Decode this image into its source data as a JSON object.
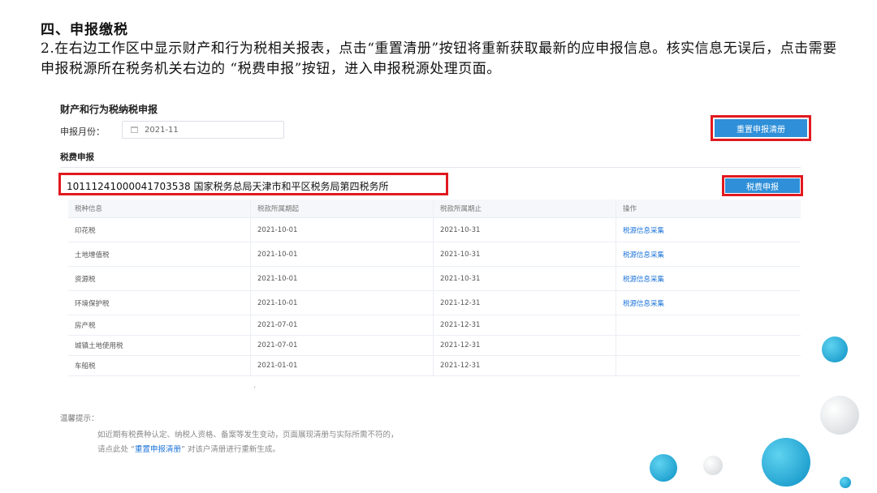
{
  "slide": {
    "heading": "四、申报缴税",
    "paragraph": "2.在右边工作区中显示财产和行为税相关报表，点击“重置清册”按钮将重新获取最新的应申报信息。核实信息无误后，点击需要申报税源所在税务机关右边的 “税费申报”按钮，进入申报税源处理页面。"
  },
  "app": {
    "section_title": "财产和行为税纳税申报",
    "month_label": "申报月份：",
    "month_value": "2021-11",
    "reset_button": "重置申报清册",
    "sub_title": "税费申报",
    "org_line": "10111241000041703538 国家税务总局天津市和平区税务局第四税务所",
    "declare_button": "税费申报",
    "table": {
      "headers": [
        "税种信息",
        "税款所属期起",
        "税款所属期止",
        "操作"
      ],
      "rows": [
        {
          "tax": "印花税",
          "start": "2021-10-01",
          "end": "2021-10-31",
          "action": "税源信息采集"
        },
        {
          "tax": "土地增值税",
          "start": "2021-10-01",
          "end": "2021-10-31",
          "action": "税源信息采集"
        },
        {
          "tax": "资源税",
          "start": "2021-10-01",
          "end": "2021-10-31",
          "action": "税源信息采集"
        },
        {
          "tax": "环境保护税",
          "start": "2021-10-01",
          "end": "2021-12-31",
          "action": "税源信息采集"
        },
        {
          "tax": "房产税",
          "start": "2021-07-01",
          "end": "2021-12-31",
          "action": ""
        },
        {
          "tax": "城镇土地使用税",
          "start": "2021-07-01",
          "end": "2021-12-31",
          "action": ""
        },
        {
          "tax": "车船税",
          "start": "2021-01-01",
          "end": "2021-12-31",
          "action": ""
        }
      ]
    },
    "dot": "·",
    "tips": {
      "title": "温馨提示：",
      "line1": "如近期有税费种认定、纳税人资格、备案等发生变动，页面展现清册与实际所需不符的，",
      "line2_pre": "请点此处 “",
      "line2_link": "重置申报清册",
      "line2_post": "” 对该户清册进行重新生成。"
    }
  },
  "colors": {
    "accent": "#2f8fd8",
    "highlight": "#e0191f",
    "link": "#1a73d9",
    "deco": "#17a9d6"
  }
}
